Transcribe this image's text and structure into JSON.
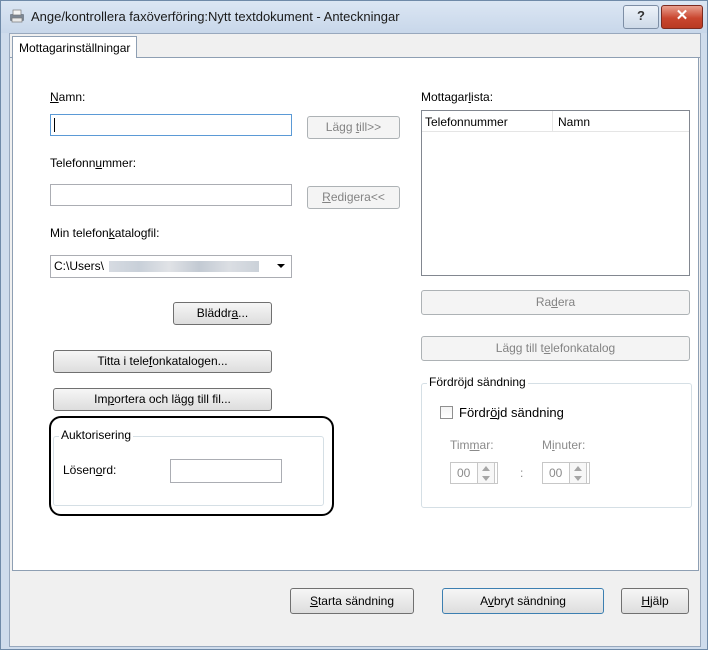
{
  "window": {
    "title": "Ange/kontrollera faxöverföring:Nytt textdokument - Anteckningar",
    "help_label": "?",
    "close_label": "✕"
  },
  "tab": {
    "label": "Mottagarinställningar"
  },
  "left": {
    "name_label_u": "N",
    "name_label_rest": "amn:",
    "name_value": "",
    "add_btn_pre": "Lägg ",
    "add_btn_u": "t",
    "add_btn_post": "ill>>",
    "phone_label_pre": "Telefonn",
    "phone_label_u": "u",
    "phone_label_post": "mmer:",
    "phone_value": "",
    "edit_btn_u": "R",
    "edit_btn_post": "edigera<<",
    "catalog_label_pre": "Min telefon",
    "catalog_label_u": "k",
    "catalog_label_post": "atalogfil:",
    "catalog_value": "C:\\Users\\",
    "browse_pre": "Bläddr",
    "browse_u": "a",
    "browse_post": "...",
    "view_catalog_pre": "Titta i tele",
    "view_catalog_u": "f",
    "view_catalog_post": "onkatalogen...",
    "import_pre": "Im",
    "import_u": "p",
    "import_post": "ortera och lägg till fil..."
  },
  "auth": {
    "group_title": "Auktorisering",
    "password_pre": "Lösen",
    "password_u": "o",
    "password_post": "rd:",
    "password_value": ""
  },
  "right": {
    "list_label_pre": "Mottagar",
    "list_label_u": "l",
    "list_label_post": "ista:",
    "columns": [
      "Telefonnummer",
      "Namn"
    ],
    "delete_pre": "Ra",
    "delete_u": "d",
    "delete_post": "era",
    "add_catalog_pre": "Lägg till t",
    "add_catalog_u": "e",
    "add_catalog_post": "lefonkatalog"
  },
  "delay": {
    "group_title": "Fördröjd sändning",
    "checkbox_pre": "Fördr",
    "checkbox_u": "ö",
    "checkbox_post": "jd sändning",
    "checked": false,
    "hours_pre": "Tim",
    "hours_u": "m",
    "hours_post": "ar:",
    "minutes_pre": "M",
    "minutes_u": "i",
    "minutes_post": "nuter:",
    "hours_value": "00",
    "minutes_value": "00",
    "separator": ":"
  },
  "footer": {
    "start_u": "S",
    "start_post": "tarta sändning",
    "cancel_pre": "A",
    "cancel_u": "v",
    "cancel_post": "bryt sändning",
    "help_u": "H",
    "help_post": "jälp"
  }
}
